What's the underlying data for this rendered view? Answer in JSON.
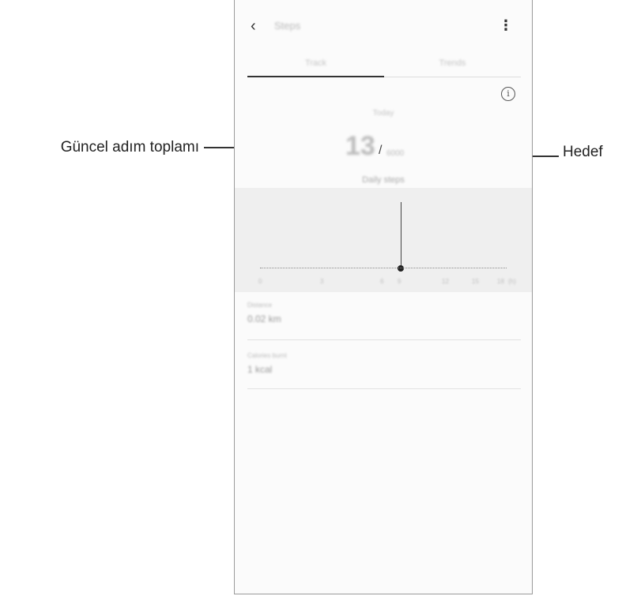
{
  "callouts": {
    "current_steps": "Güncel adım toplamı",
    "target": "Hedef"
  },
  "app": {
    "title": "Steps",
    "tabs": [
      {
        "label": "Track",
        "active": true
      },
      {
        "label": "Trends",
        "active": false
      }
    ],
    "today_label": "Today",
    "steps_value": "13",
    "goal_separator": "/",
    "goal_value": "6000",
    "daily_label": "Daily steps",
    "graph": {
      "axis_ticks": [
        "0",
        "3",
        "6",
        "9",
        "12",
        "15",
        "18",
        "(h)"
      ],
      "current_marker_hour": 9
    },
    "stats": [
      {
        "label": "Distance",
        "value": "0.02 km"
      },
      {
        "label": "Calories burnt",
        "value": "1 kcal"
      }
    ]
  },
  "icons": {
    "back": "chevron-left-icon",
    "more": "more-vertical-icon",
    "info": "info-icon"
  }
}
